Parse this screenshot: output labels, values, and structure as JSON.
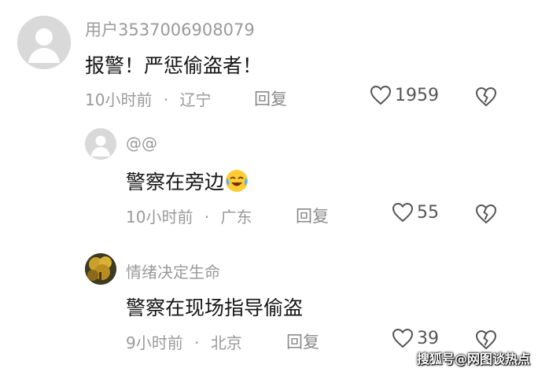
{
  "comments": [
    {
      "username": "用户3537006908079",
      "content": "报警！严惩偷盗者！",
      "time": "10小时前",
      "location": "辽宁",
      "reply_label": "回复",
      "likes": "1959",
      "avatar": "default-avatar"
    },
    {
      "username": "@@",
      "content": "警察在旁边",
      "emoji": "crying-laughing-emoji",
      "time": "10小时前",
      "location": "广东",
      "reply_label": "回复",
      "likes": "55",
      "avatar": "default-avatar"
    },
    {
      "username": "情绪决定生命",
      "content": "警察在现场指导偷盗",
      "time": "9小时前",
      "location": "北京",
      "reply_label": "回复",
      "likes": "39",
      "avatar": "photo-avatar"
    }
  ],
  "separator": "·",
  "watermark": "搜狐号@网图谈热点",
  "colors": {
    "meta_text": "#9a9a9a",
    "content_text": "#161616",
    "avatar_bg": "#d9d9d9"
  }
}
